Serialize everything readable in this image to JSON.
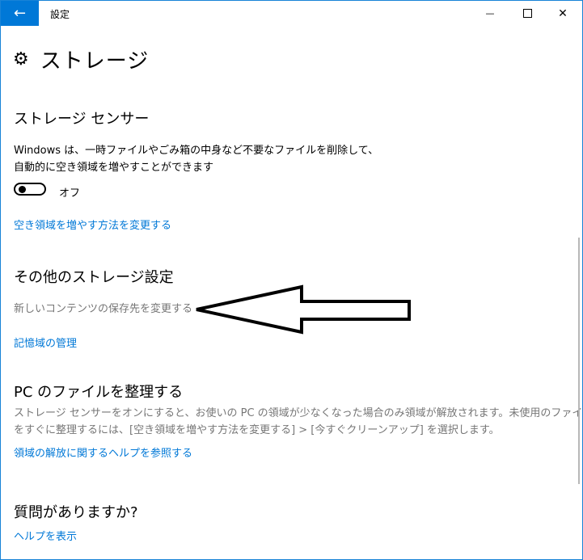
{
  "window": {
    "title": "設定",
    "back_icon": "←",
    "minimize_icon": "—",
    "close_icon": "✕"
  },
  "page": {
    "title": "ストレージ",
    "gear_icon": "⚙"
  },
  "storage_sense": {
    "heading": "ストレージ センサー",
    "description_line1": "Windows は、一時ファイルやごみ箱の中身など不要なファイルを削除して、",
    "description_line2": "自動的に空き領域を増やすことができます",
    "toggle_state": "オフ",
    "change_link": "空き領域を増やす方法を変更する"
  },
  "other_settings": {
    "heading": "その他のストレージ設定",
    "change_save_location": "新しいコンテンツの保存先を変更する",
    "manage_link": "記憶域の管理"
  },
  "organize": {
    "heading": "PC のファイルを整理する",
    "description_line1": "ストレージ センサーをオンにすると、お使いの PC の領域が少なくなった場合のみ領域が解放されます。未使用のファイル",
    "description_line2": "をすぐに整理するには、[空き領域を増やす方法を変更する] > [今すぐクリーンアップ] を選択します。",
    "help_link": "領域の解放に関するヘルプを参照する"
  },
  "questions": {
    "heading": "質問がありますか?",
    "help_link": "ヘルプを表示"
  },
  "colors": {
    "accent": "#0078d7",
    "gray_text": "#767676"
  }
}
